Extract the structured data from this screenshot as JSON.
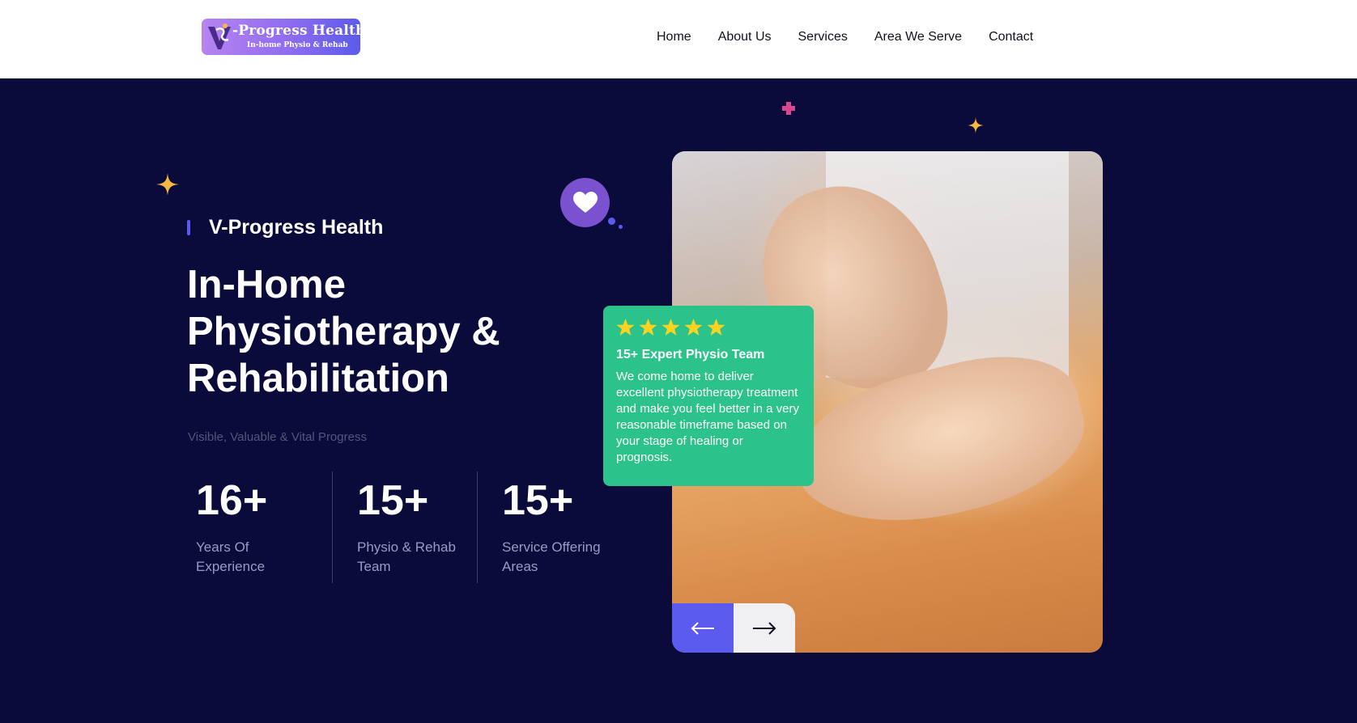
{
  "header": {
    "logo": {
      "title": "-Progress Health",
      "subtitle": "In-home Physio & Rehab"
    },
    "nav": [
      "Home",
      "About Us",
      "Services",
      "Area We Serve",
      "Contact"
    ]
  },
  "hero": {
    "eyebrow": "V-Progress Health",
    "headline": "In-Home Physiotherapy & Rehabilitation",
    "tagline": "Visible, Valuable & Vital Progress",
    "stats": [
      {
        "value": "16+",
        "label": "Years Of Experience"
      },
      {
        "value": "15+",
        "label": "Physio & Rehab Team"
      },
      {
        "value": "15+",
        "label": "Service Offering Areas"
      }
    ]
  },
  "review_card": {
    "rating": 5,
    "title": "15+ Expert Physio Team",
    "text": "We come home to deliver excellent physiotherapy treatment and make you feel better in a very reasonable timeframe based on your stage of healing or prognosis."
  },
  "icons": {
    "heart": "heart-icon",
    "star": "star-icon",
    "prev": "arrow-left-icon",
    "next": "arrow-right-icon",
    "sparkle": "sparkle-icon",
    "plus": "plus-icon"
  },
  "colors": {
    "background": "#0b0b3b",
    "accent": "#5b5bf0",
    "card": "#2bc38a",
    "star": "#ffd21f",
    "heart_badge": "#7a52cf",
    "sparkle": "#f5b942",
    "plus": "#d9488f"
  }
}
